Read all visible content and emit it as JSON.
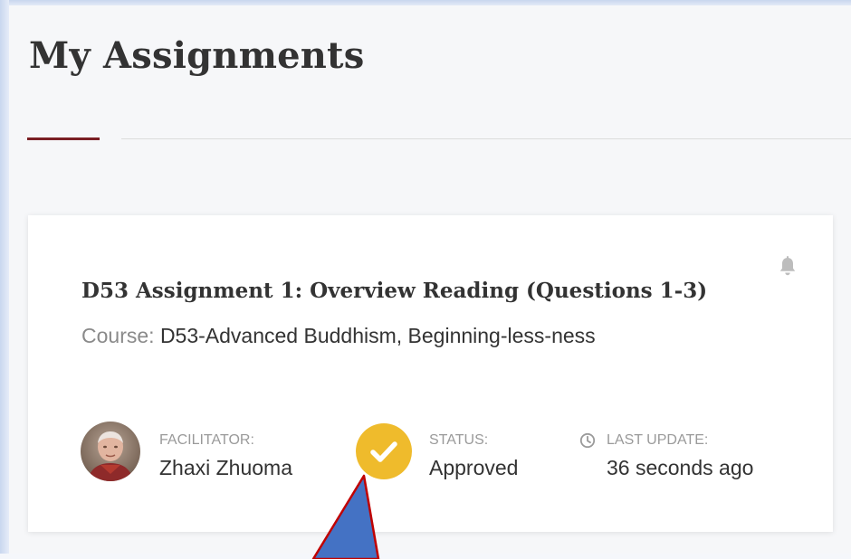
{
  "page": {
    "title": "My Assignments"
  },
  "assignment": {
    "title": "D53 Assignment 1: Overview Reading (Questions 1-3)",
    "course_label": "Course:",
    "course_name": "D53-Advanced Buddhism, Beginning-less-ness",
    "facilitator_label": "FACILITATOR:",
    "facilitator_name": "Zhaxi Zhuoma",
    "status_label": "STATUS:",
    "status_value": "Approved",
    "update_label": "LAST UPDATE:",
    "update_value": "36 seconds ago",
    "icons": {
      "notification": "bell-icon",
      "status": "check-circle-icon",
      "update": "clock-icon"
    }
  },
  "colors": {
    "accent": "#7a1f24",
    "status_approved": "#efbb2c",
    "annotation_arrow": "#4472c4"
  }
}
